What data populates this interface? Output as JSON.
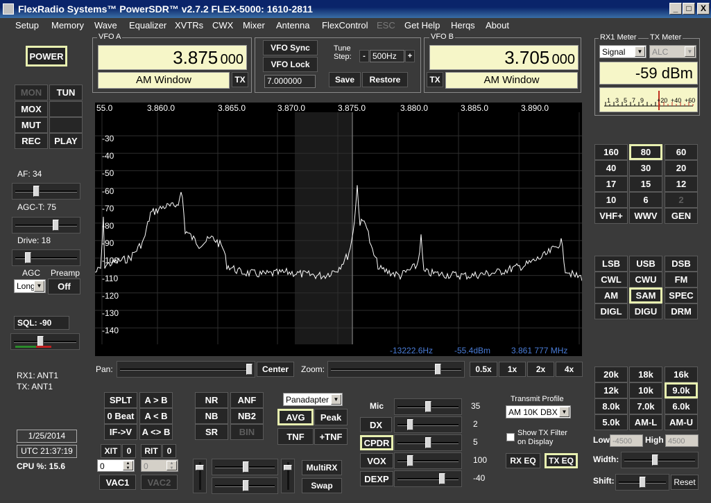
{
  "window": {
    "title": "FlexRadio Systems™  PowerSDR™  v2.7.2   FLEX-5000: 1610-2811",
    "min": "_",
    "max": "□",
    "close": "X"
  },
  "menu": [
    "Setup",
    "Memory",
    "Wave",
    "Equalizer",
    "XVTRs",
    "CWX",
    "Mixer",
    "Antenna",
    "FlexControl",
    "ESC",
    "Get Help",
    "Herqs",
    "About"
  ],
  "power_label": "POWER",
  "left_buttons": {
    "mon": "MON",
    "tun": "TUN",
    "mox": "MOX",
    "mut": "MUT",
    "rec": "REC",
    "play": "PLAY"
  },
  "af": {
    "label": "AF:  34",
    "value": 34
  },
  "agct": {
    "label": "AGC-T:  75",
    "value": 75
  },
  "drive": {
    "label": "Drive:  18",
    "value": 18
  },
  "agc": {
    "label": "AGC",
    "value": "Long",
    "preamp_label": "Preamp",
    "preamp_value": "Off"
  },
  "sql": {
    "label": "SQL:  -90",
    "value": -90
  },
  "antennas": {
    "rx1": "RX1: ANT1",
    "tx": "TX: ANT1"
  },
  "date": "1/25/2014",
  "utc": "UTC 21:37:19",
  "cpu": "CPU %: 15.6",
  "vfo_a": {
    "label": "VFO A",
    "freq": "3.875",
    "freq_small": "000",
    "mode": "AM Window",
    "tx": "TX"
  },
  "vfo_center": {
    "sync": "VFO Sync",
    "lock": "VFO Lock",
    "tune_step_label": "Tune Step:",
    "minus": "-",
    "step": "500Hz",
    "plus": "+",
    "memory_value": "7.000000",
    "save": "Save",
    "restore": "Restore"
  },
  "vfo_b": {
    "label": "VFO B",
    "freq": "3.705",
    "freq_small": "000",
    "mode": "AM Window",
    "tx": "TX"
  },
  "meters": {
    "rx1_label": "RX1 Meter",
    "tx_label": "TX Meter",
    "rx1_value": "Signal",
    "tx_value": "ALC",
    "reading": "-59 dBm",
    "scale": [
      "1",
      "3",
      "5",
      "7",
      "9",
      "+20",
      "+40",
      "+60"
    ]
  },
  "spectrum": {
    "freq_labels": [
      "55.0",
      "3.860.0",
      "3.865.0",
      "3.870.0",
      "3.875.0",
      "3.880.0",
      "3.885.0",
      "3.890.0"
    ],
    "db_labels": [
      "-30",
      "-40",
      "-50",
      "-60",
      "-70",
      "-80",
      "-90",
      "-100",
      "-110",
      "-120",
      "-130",
      "-140"
    ],
    "info_hz": "-13222.6Hz",
    "info_dbm": "-55.4dBm",
    "info_mhz": "3.861 777 MHz"
  },
  "pan": {
    "label": "Pan:",
    "center": "Center",
    "zoom_label": "Zoom:",
    "z05": "0.5x",
    "z1": "1x",
    "z2": "2x",
    "z4": "4x"
  },
  "bands": [
    [
      "160",
      "80",
      "60"
    ],
    [
      "40",
      "30",
      "20"
    ],
    [
      "17",
      "15",
      "12"
    ],
    [
      "10",
      "6",
      "2"
    ],
    [
      "VHF+",
      "WWV",
      "GEN"
    ]
  ],
  "modes": [
    [
      "LSB",
      "USB",
      "DSB"
    ],
    [
      "CWL",
      "CWU",
      "FM"
    ],
    [
      "AM",
      "SAM",
      "SPEC"
    ],
    [
      "DIGL",
      "DIGU",
      "DRM"
    ]
  ],
  "filters": [
    [
      "20k",
      "18k",
      "16k"
    ],
    [
      "12k",
      "10k",
      "9.0k"
    ],
    [
      "8.0k",
      "7.0k",
      "6.0k"
    ],
    [
      "5.0k",
      "AM-L",
      "AM-U"
    ]
  ],
  "filter_ctrl": {
    "low_label": "Low",
    "low": "-4500",
    "high_label": "High",
    "high": "4500",
    "width_label": "Width:",
    "shift_label": "Shift:",
    "reset": "Reset"
  },
  "dsp": {
    "splt": "SPLT",
    "a_b": "A > B",
    "zero_beat": "0 Beat",
    "a_lt_b": "A < B",
    "if_v": "IF->V",
    "a_swap": "A <> B",
    "nr": "NR",
    "anf": "ANF",
    "nb": "NB",
    "nb2": "NB2",
    "sr": "SR",
    "bin": "BIN",
    "display_mode": "Panadapter",
    "avg": "AVG",
    "peak": "Peak",
    "tnf": "TNF",
    "plus_tnf": "+TNF"
  },
  "xit_rit": {
    "xit": "XIT",
    "xit_on": "0",
    "rit": "RIT",
    "rit_on": "0",
    "xit_val": "0",
    "rit_val": "0",
    "vac1": "VAC1",
    "vac2": "VAC2",
    "multirx": "MultiRX",
    "swap": "Swap"
  },
  "tx_ctrl": {
    "mic": "Mic",
    "mic_val": "35",
    "dx": "DX",
    "dx_val": "2",
    "cpdr": "CPDR",
    "cpdr_val": "5",
    "vox": "VOX",
    "vox_val": "100",
    "dexp": "DEXP",
    "dexp_val": "-40"
  },
  "profile": {
    "label": "Transmit Profile",
    "value": "AM 10K DBX",
    "show_filter": "Show TX Filter",
    "on_display": "on Display",
    "rx_eq": "RX EQ",
    "tx_eq": "TX EQ"
  },
  "colors": {
    "lcd": "#f6f6c8",
    "highlight": "#e8f0b0",
    "bg": "#3a3a3a",
    "info": "#4a7dd8"
  }
}
